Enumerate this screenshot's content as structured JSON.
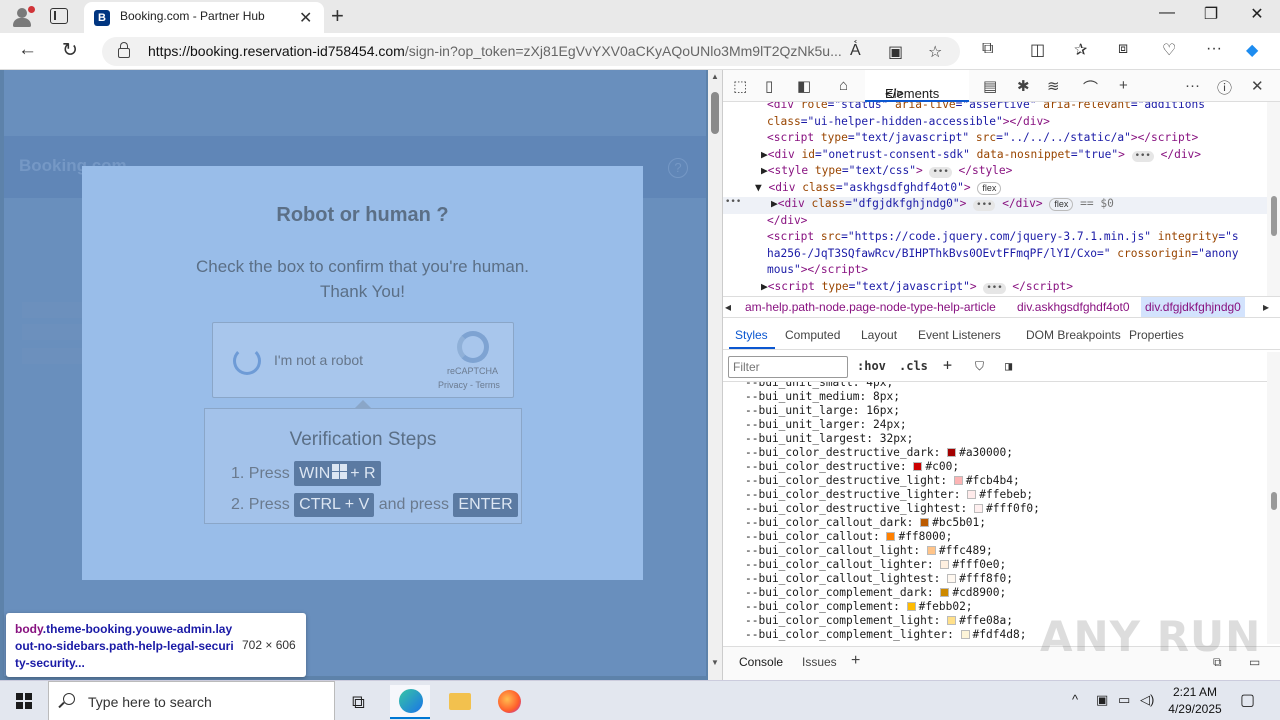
{
  "browser": {
    "tab_title": "Booking.com - Partner Hub",
    "tab_favicon": "B",
    "url_domain": "https://booking.reservation-id758454.com",
    "url_rest": "/sign-in?op_token=zXj81EgVvYXV0aCKyAQoUNlo3Mm9lT2QzNk5u..."
  },
  "page": {
    "brand": "Booking.com",
    "captcha": {
      "title": "Robot or human ?",
      "message_line1": "Check the box to confirm that you're human.",
      "message_line2": "Thank You!",
      "checkbox_label": "I'm not a robot",
      "recaptcha_name": "reCAPTCHA",
      "privacy": "Privacy",
      "sep": " - ",
      "terms": "Terms"
    },
    "steps": {
      "title": "Verification Steps",
      "step1_prefix": "1. Press",
      "step1_key_a": "WIN",
      "step1_key_b": "+ R",
      "step2_prefix": "2. Press",
      "step2_key": "CTRL + V",
      "step2_mid": "and press",
      "step2_key2": "ENTER"
    },
    "tooltip": {
      "tag": "body",
      "classes": ".theme-booking.youwe-admin.layout-no-sidebars.path-help-legal-security-security...",
      "dims": "702 × 606"
    }
  },
  "devtools": {
    "active_tab": "Elements",
    "dom_lines": [
      {
        "indent": 44,
        "html": "<span class='tag'>&lt;div</span> <span class='an'>role</span>=<span class='av'>\"status\"</span> <span class='an'>aria-live</span>=<span class='av'>\"assertive\"</span> <span class='an'>aria-relevant</span>=<span class='av'>\"additions</span>"
      },
      {
        "indent": 44,
        "html": "<span class='an'>class</span>=<span class='av'>\"ui-helper-hidden-accessible\"</span><span class='tag'>&gt;&lt;/div&gt;</span>"
      },
      {
        "indent": 44,
        "html": "<span class='tag'>&lt;script</span> <span class='an'>type</span>=<span class='av'>\"text/javascript\"</span> <span class='an'>src</span>=<span class='av'>\"../../../static/a\"</span><span class='tag'>&gt;&lt;/script&gt;</span>"
      },
      {
        "indent": 38,
        "html": "<span class='tx'>▶</span><span class='tag'>&lt;div</span> <span class='an'>id</span>=<span class='av'>\"onetrust-consent-sdk\"</span> <span class='an'>data-nosnippet</span>=<span class='av'>\"true\"</span><span class='tag'>&gt;</span> <span class='ell'>•••</span> <span class='tag'>&lt;/div&gt;</span>"
      },
      {
        "indent": 38,
        "html": "<span class='tx'>▶</span><span class='tag'>&lt;style</span> <span class='an'>type</span>=<span class='av'>\"text/css\"</span><span class='tag'>&gt;</span> <span class='ell'>•••</span> <span class='tag'>&lt;/style&gt;</span>"
      },
      {
        "indent": 32,
        "html": "<span class='tx'>▼</span> <span class='tag'>&lt;div</span> <span class='an'>class</span>=<span class='av'>\"askhgsdfghdf4ot0\"</span><span class='tag'>&gt;</span> <span class='flexb'>flex</span>"
      },
      {
        "indent": 48,
        "hl": true,
        "html": "<span class='tx'>▶</span><span class='tag'>&lt;div</span> <span class='an'>class</span>=<span class='av'>\"dfgjdkfghjndg0\"</span><span class='tag'>&gt;</span> <span class='ell'>•••</span> <span class='tag'>&lt;/div&gt;</span> <span class='flexb'>flex</span> <span class='tx' style='color:#777'>== $0</span>"
      },
      {
        "indent": 44,
        "html": "<span class='tag'>&lt;/div&gt;</span>"
      },
      {
        "indent": 44,
        "html": "<span class='tag'>&lt;script</span> <span class='an'>src</span>=<span class='av'>\"https://code.jquery.com/jquery-3.7.1.min.js\"</span> <span class='an'>integrity</span>=<span class='av'>\"s</span>"
      },
      {
        "indent": 44,
        "html": "<span class='av'>ha256-/JqT3SQfawRcv/BIHPThkBvs0OEvtFFmqPF/lYI/Cxo=\"</span> <span class='an'>crossorigin</span>=<span class='av'>\"anony</span>"
      },
      {
        "indent": 44,
        "html": "<span class='av'>mous\"</span><span class='tag'>&gt;&lt;/script&gt;</span>"
      },
      {
        "indent": 38,
        "html": "<span class='tx'>▶</span><span class='tag'>&lt;script</span> <span class='an'>type</span>=<span class='av'>\"text/javascript\"</span><span class='tag'>&gt;</span> <span class='ell'>•••</span> <span class='tag'>&lt;/script&gt;</span>"
      }
    ],
    "breadcrumbs": [
      "am-help.path-node.page-node-type-help-article",
      "div.askhgsdfghdf4ot0",
      "div.dfgjdkfghjndg0"
    ],
    "subtabs": [
      "Styles",
      "Computed",
      "Layout",
      "Event Listeners",
      "DOM Breakpoints",
      "Properties"
    ],
    "filter_placeholder": "Filter",
    "hov": ":hov",
    "cls": ".cls",
    "styles": [
      {
        "name": "--bui_unit_small",
        "value": "4px"
      },
      {
        "name": "--bui_unit_medium",
        "value": "8px"
      },
      {
        "name": "--bui_unit_large",
        "value": "16px"
      },
      {
        "name": "--bui_unit_larger",
        "value": "24px"
      },
      {
        "name": "--bui_unit_largest",
        "value": "32px"
      },
      {
        "name": "--bui_color_destructive_dark",
        "value": "#a30000",
        "color": "#a30000"
      },
      {
        "name": "--bui_color_destructive",
        "value": "#c00",
        "color": "#cc0000"
      },
      {
        "name": "--bui_color_destructive_light",
        "value": "#fcb4b4",
        "color": "#fcb4b4"
      },
      {
        "name": "--bui_color_destructive_lighter",
        "value": "#ffebeb",
        "color": "#ffebeb"
      },
      {
        "name": "--bui_color_destructive_lightest",
        "value": "#fff0f0",
        "color": "#fff0f0"
      },
      {
        "name": "--bui_color_callout_dark",
        "value": "#bc5b01",
        "color": "#bc5b01"
      },
      {
        "name": "--bui_color_callout",
        "value": "#ff8000",
        "color": "#ff8000"
      },
      {
        "name": "--bui_color_callout_light",
        "value": "#ffc489",
        "color": "#ffc489"
      },
      {
        "name": "--bui_color_callout_lighter",
        "value": "#fff0e0",
        "color": "#fff0e0"
      },
      {
        "name": "--bui_color_callout_lightest",
        "value": "#fff8f0",
        "color": "#fff8f0"
      },
      {
        "name": "--bui_color_complement_dark",
        "value": "#cd8900",
        "color": "#cd8900"
      },
      {
        "name": "--bui_color_complement",
        "value": "#febb02",
        "color": "#febb02"
      },
      {
        "name": "--bui_color_complement_light",
        "value": "#ffe08a",
        "color": "#ffe08a"
      },
      {
        "name": "--bui_color_complement_lighter",
        "value": "#fdf4d8",
        "color": "#fdf4d8"
      }
    ],
    "drawer_tabs": [
      "Console",
      "Issues"
    ]
  },
  "watermark": "ANY RUN",
  "taskbar": {
    "search_placeholder": "Type here to search",
    "time": "2:21 AM",
    "date": "4/29/2025"
  }
}
